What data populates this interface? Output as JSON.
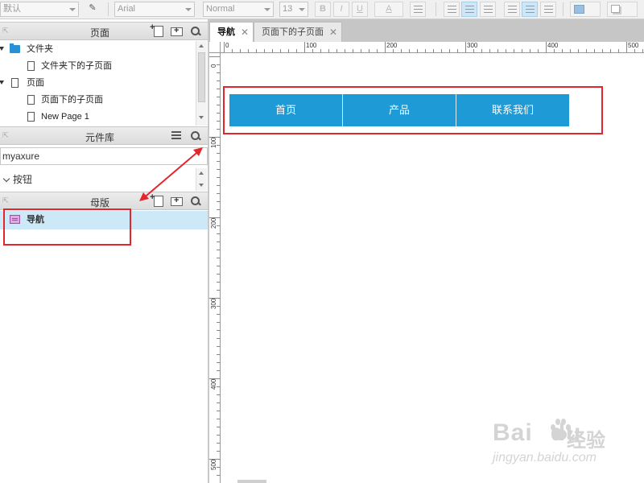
{
  "toolbar": {
    "style_select": "默认",
    "font_family": "Arial",
    "font_weight": "Normal",
    "font_size": "13",
    "bold": "B",
    "italic": "I",
    "underline": "U",
    "font_color": "A"
  },
  "pages_panel": {
    "title": "页面",
    "items": [
      {
        "label": "文件夹",
        "type": "folder"
      },
      {
        "label": "文件夹下的子页面",
        "type": "page"
      },
      {
        "label": "页面",
        "type": "page"
      },
      {
        "label": "页面下的子页面",
        "type": "page"
      },
      {
        "label": "New Page 1",
        "type": "page"
      }
    ]
  },
  "library_panel": {
    "title": "元件库",
    "selected_library": "myaxure",
    "category": "按钮"
  },
  "masters_panel": {
    "title": "母版",
    "items": [
      {
        "label": "导航",
        "selected": true
      }
    ]
  },
  "tabs": [
    {
      "label": "导航",
      "active": true
    },
    {
      "label": "页面下的子页面",
      "active": false
    }
  ],
  "ruler": {
    "h_labels": [
      "0",
      "100",
      "200",
      "300",
      "400",
      "500"
    ],
    "v_labels": [
      "0",
      "100",
      "200",
      "300",
      "400",
      "500"
    ]
  },
  "canvas": {
    "nav_items": [
      "首页",
      "产品",
      "联系我们"
    ],
    "nav_color": "#1e9ad6"
  },
  "annotation_color": "#e3262c",
  "watermark": {
    "brand": "Bai",
    "brand_tail": "du",
    "cn": "经验",
    "url": "jingyan.baidu.com"
  }
}
